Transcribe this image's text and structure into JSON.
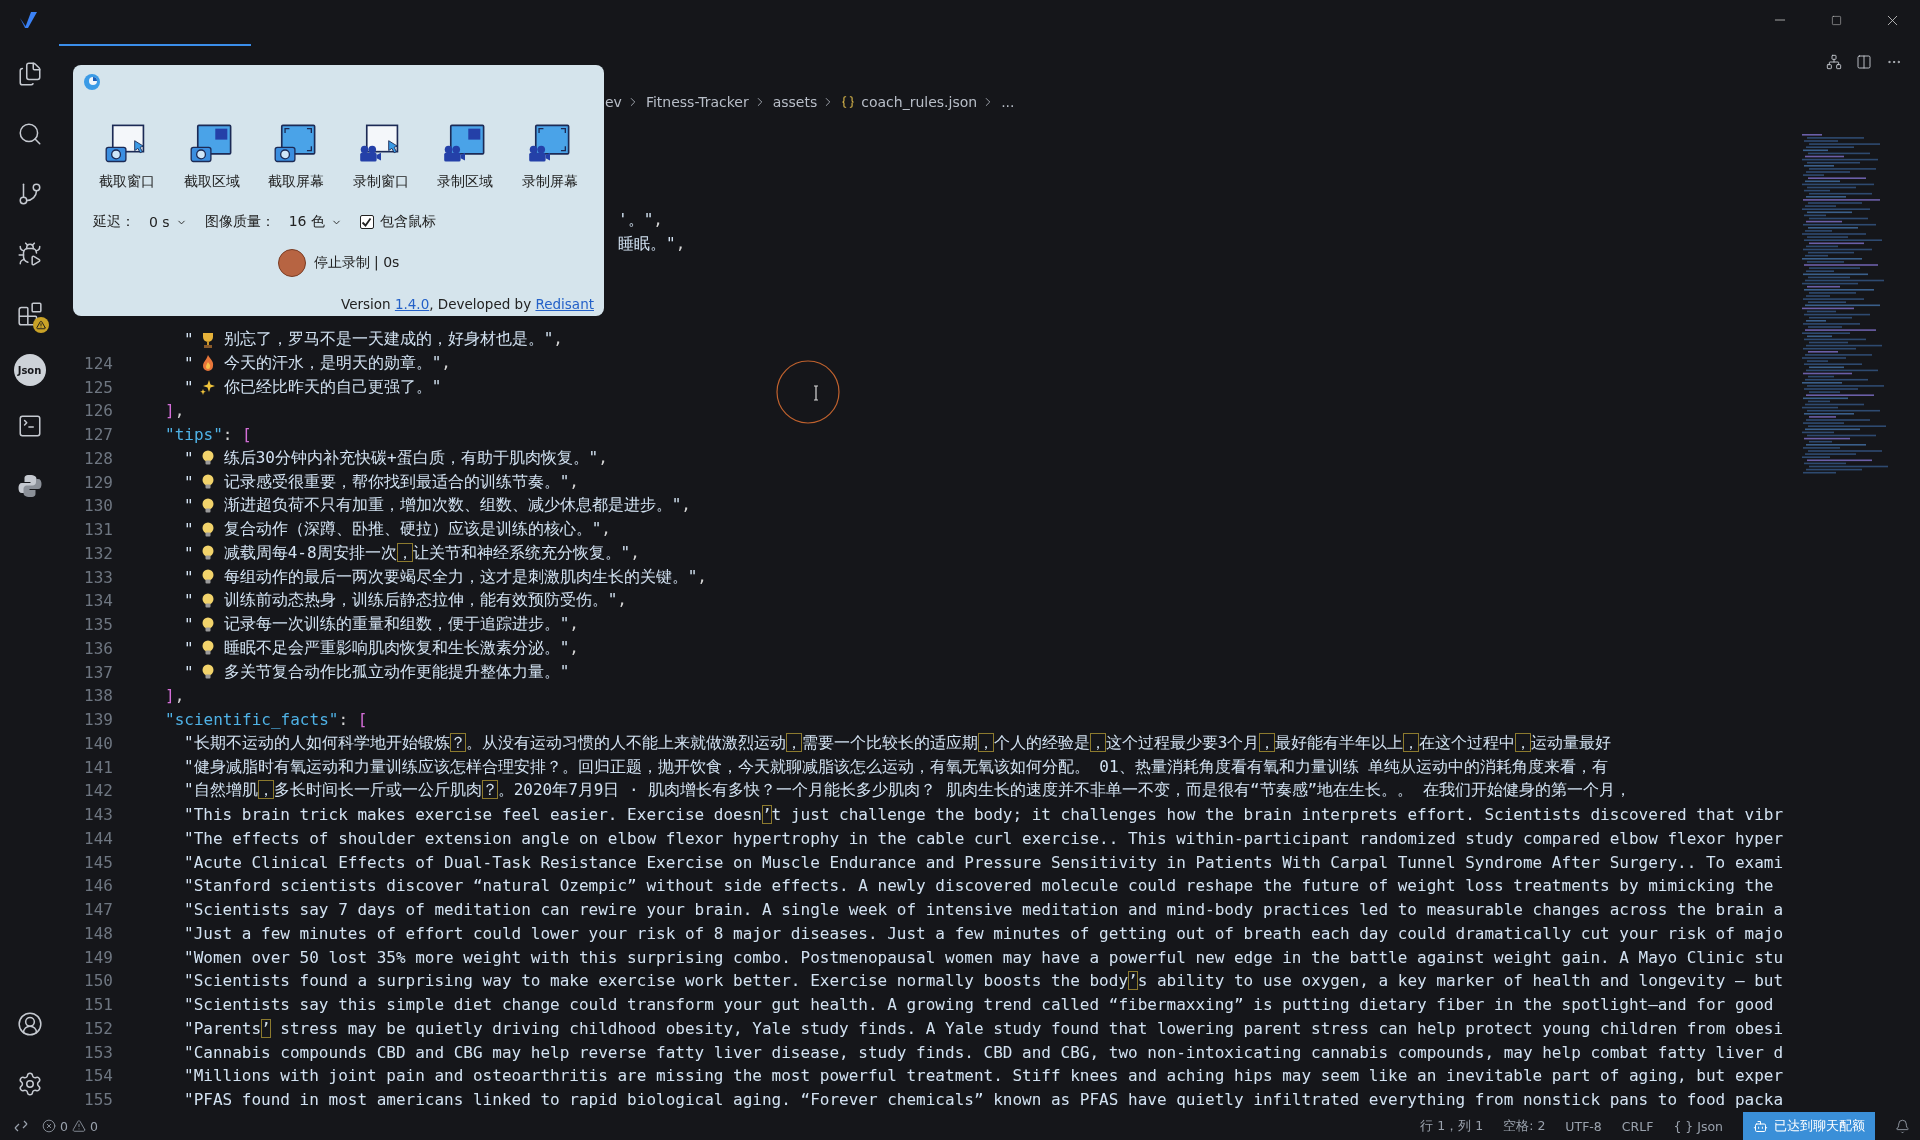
{
  "breadcrumbs": [
    {
      "label": "ev",
      "kind": "folder"
    },
    {
      "label": "Fitness-Tracker",
      "kind": "folder"
    },
    {
      "label": "assets",
      "kind": "folder"
    },
    {
      "label": "coach_rules.json",
      "kind": "json"
    },
    {
      "label": "...",
      "kind": "more"
    }
  ],
  "capture_popup": {
    "tools": [
      {
        "label": "截取窗口",
        "kind": "capture_window"
      },
      {
        "label": "截取区域",
        "kind": "capture_region"
      },
      {
        "label": "截取屏幕",
        "kind": "capture_screen"
      },
      {
        "label": "录制窗口",
        "kind": "record_window"
      },
      {
        "label": "录制区域",
        "kind": "record_region"
      },
      {
        "label": "录制屏幕",
        "kind": "record_screen"
      }
    ],
    "delay_label": "延迟：",
    "delay_value": "0 s",
    "quality_label": "图像质量：",
    "quality_value": "16 色",
    "include_cursor": {
      "label": "包含鼠标",
      "checked": true
    },
    "record_label": "停止录制 | 0s",
    "footer": {
      "prefix": "Version ",
      "version": "1.4.0",
      "middle": ", Developed by ",
      "author": "Redisant"
    }
  },
  "activity_bar": {
    "json_badge": "Json"
  },
  "lines": [
    {
      "kind": "covered"
    },
    {
      "kind": "covered"
    },
    {
      "kind": "covered"
    },
    {
      "kind": "covered"
    },
    {
      "kind": "partial",
      "tokens": [
        {
          "kind": "str",
          "text": "'。\""
        },
        {
          "kind": "punct",
          "text": ","
        }
      ]
    },
    {
      "kind": "partial",
      "tokens": [
        {
          "kind": "str",
          "text": "睡眠。\""
        },
        {
          "kind": "punct",
          "text": ","
        }
      ]
    },
    {
      "kind": "covered"
    },
    {
      "kind": "covered"
    },
    {
      "kind": "covered"
    },
    {
      "kind": "item",
      "tokens": [
        {
          "kind": "str",
          "text": "\""
        },
        {
          "kind": "trophy"
        },
        {
          "kind": "str",
          "text": "别忘了，罗马不是一天建成的，好身材也是。\""
        },
        {
          "kind": "punct",
          "text": ","
        }
      ]
    },
    {
      "kind": "item",
      "number": "124",
      "tokens": [
        {
          "kind": "str",
          "text": "\""
        },
        {
          "kind": "flame"
        },
        {
          "kind": "str",
          "text": "今天的汗水，是明天的勋章。\""
        },
        {
          "kind": "punct",
          "text": ","
        }
      ]
    },
    {
      "kind": "item",
      "number": "125",
      "tokens": [
        {
          "kind": "str",
          "text": "\""
        },
        {
          "kind": "sparkles"
        },
        {
          "kind": "str",
          "text": "你已经比昨天的自己更强了。\""
        }
      ]
    },
    {
      "kind": "close",
      "number": "126",
      "tokens": [
        {
          "kind": "bracket",
          "text": "]"
        },
        {
          "kind": "punct",
          "text": ","
        }
      ]
    },
    {
      "kind": "key",
      "number": "127",
      "tokens": [
        {
          "kind": "key",
          "text": "\"tips\""
        },
        {
          "kind": "punct",
          "text": ": "
        },
        {
          "kind": "bracket",
          "text": "["
        }
      ]
    },
    {
      "kind": "item",
      "number": "128",
      "tokens": [
        {
          "kind": "str",
          "text": "\""
        },
        {
          "kind": "bulb"
        },
        {
          "kind": "str",
          "text": "练后30分钟内补充快碳+蛋白质，有助于肌肉恢复。\""
        },
        {
          "kind": "punct",
          "text": ","
        }
      ]
    },
    {
      "kind": "item",
      "number": "129",
      "tokens": [
        {
          "kind": "str",
          "text": "\""
        },
        {
          "kind": "bulb"
        },
        {
          "kind": "str",
          "text": "记录感受很重要，帮你找到最适合的训练节奏。\""
        },
        {
          "kind": "punct",
          "text": ","
        }
      ]
    },
    {
      "kind": "item",
      "number": "130",
      "tokens": [
        {
          "kind": "str",
          "text": "\""
        },
        {
          "kind": "bulb"
        },
        {
          "kind": "str",
          "text": "渐进超负荷不只有加重，增加次数、组数、减少休息都是进步。\""
        },
        {
          "kind": "punct",
          "text": ","
        }
      ]
    },
    {
      "kind": "item",
      "number": "131",
      "tokens": [
        {
          "kind": "str",
          "text": "\""
        },
        {
          "kind": "bulb"
        },
        {
          "kind": "str",
          "text": "复合动作（深蹲、卧推、硬拉）应该是训练的核心。\""
        },
        {
          "kind": "punct",
          "text": ","
        }
      ]
    },
    {
      "kind": "item",
      "number": "132",
      "tokens": [
        {
          "kind": "str",
          "text": "\""
        },
        {
          "kind": "bulb"
        },
        {
          "kind": "str",
          "text": "减载周每4-8周安排一次"
        },
        {
          "kind": "flag",
          "text": "，"
        },
        {
          "kind": "str",
          "text": "让关节和神经系统充分恢复。\""
        },
        {
          "kind": "punct",
          "text": ","
        }
      ]
    },
    {
      "kind": "item",
      "number": "133",
      "tokens": [
        {
          "kind": "str",
          "text": "\""
        },
        {
          "kind": "bulb"
        },
        {
          "kind": "str",
          "text": "每组动作的最后一两次要竭尽全力，这才是刺激肌肉生长的关键。\""
        },
        {
          "kind": "punct",
          "text": ","
        }
      ]
    },
    {
      "kind": "item",
      "number": "134",
      "tokens": [
        {
          "kind": "str",
          "text": "\""
        },
        {
          "kind": "bulb"
        },
        {
          "kind": "str",
          "text": "训练前动态热身，训练后静态拉伸，能有效预防受伤。\""
        },
        {
          "kind": "punct",
          "text": ","
        }
      ]
    },
    {
      "kind": "item",
      "number": "135",
      "tokens": [
        {
          "kind": "str",
          "text": "\""
        },
        {
          "kind": "bulb"
        },
        {
          "kind": "str",
          "text": "记录每一次训练的重量和组数，便于追踪进步。\""
        },
        {
          "kind": "punct",
          "text": ","
        }
      ]
    },
    {
      "kind": "item",
      "number": "136",
      "tokens": [
        {
          "kind": "str",
          "text": "\""
        },
        {
          "kind": "bulb"
        },
        {
          "kind": "str",
          "text": "睡眠不足会严重影响肌肉恢复和生长激素分泌。\""
        },
        {
          "kind": "punct",
          "text": ","
        }
      ]
    },
    {
      "kind": "item",
      "number": "137",
      "tokens": [
        {
          "kind": "str",
          "text": "\""
        },
        {
          "kind": "bulb"
        },
        {
          "kind": "str",
          "text": "多关节复合动作比孤立动作更能提升整体力量。\""
        }
      ]
    },
    {
      "kind": "close",
      "number": "138",
      "tokens": [
        {
          "kind": "bracket",
          "text": "]"
        },
        {
          "kind": "punct",
          "text": ","
        }
      ]
    },
    {
      "kind": "key",
      "number": "139",
      "tokens": [
        {
          "kind": "key",
          "text": "\"scientific_facts\""
        },
        {
          "kind": "punct",
          "text": ": "
        },
        {
          "kind": "bracket",
          "text": "["
        }
      ]
    },
    {
      "kind": "item",
      "number": "140",
      "tokens": [
        {
          "kind": "str",
          "text": "\"长期不运动的人如何科学地开始锻炼"
        },
        {
          "kind": "flag",
          "text": "？"
        },
        {
          "kind": "str",
          "text": "。从没有运动习惯的人不能上来就做激烈运动"
        },
        {
          "kind": "flag",
          "text": "，"
        },
        {
          "kind": "str",
          "text": "需要一个比较长的适应期"
        },
        {
          "kind": "flag",
          "text": "，"
        },
        {
          "kind": "str",
          "text": "个人的经验是"
        },
        {
          "kind": "flag",
          "text": "，"
        },
        {
          "kind": "str",
          "text": "这个过程最少要3个月"
        },
        {
          "kind": "flag",
          "text": "，"
        },
        {
          "kind": "str",
          "text": "最好能有半年以上"
        },
        {
          "kind": "flag",
          "text": "，"
        },
        {
          "kind": "str",
          "text": "在这个过程中"
        },
        {
          "kind": "flag",
          "text": "，"
        },
        {
          "kind": "str",
          "text": "运动量最好"
        }
      ]
    },
    {
      "kind": "item",
      "number": "141",
      "tokens": [
        {
          "kind": "str",
          "text": "\"健身减脂时有氧运动和力量训练应该怎样合理安排？。回归正题，抛开饮食，今天就聊减脂该怎么运动，有氧无氧该如何分配。 01、热量消耗角度看有氧和力量训练 单纯从运动中的消耗角度来看，有"
        }
      ]
    },
    {
      "kind": "item",
      "number": "142",
      "tokens": [
        {
          "kind": "str",
          "text": "\"自然增肌"
        },
        {
          "kind": "flag",
          "text": "，"
        },
        {
          "kind": "str",
          "text": "多长时间长一斤或一公斤肌肉"
        },
        {
          "kind": "flag",
          "text": "？"
        },
        {
          "kind": "str",
          "text": "。2020年7月9日 · 肌肉增长有多快？一个月能长多少肌肉？ 肌肉生长的速度并不非单一不变，而是很有“节奏感”地在生长。。 在我们开始健身的第一个月，"
        }
      ]
    },
    {
      "kind": "item",
      "number": "143",
      "tokens": [
        {
          "kind": "str",
          "text": "\"This brain trick makes exercise feel easier. Exercise doesn"
        },
        {
          "kind": "flag",
          "text": "’"
        },
        {
          "kind": "str",
          "text": "t just challenge the body; it challenges how the brain interprets effort. Scientists discovered that vibr"
        }
      ]
    },
    {
      "kind": "item",
      "number": "144",
      "tokens": [
        {
          "kind": "str",
          "text": "\"The effects of shoulder extension angle on elbow flexor hypertrophy in the cable curl exercise.. This within-participant randomized study compared elbow flexor hyper"
        }
      ]
    },
    {
      "kind": "item",
      "number": "145",
      "tokens": [
        {
          "kind": "str",
          "text": "\"Acute Clinical Effects of Dual-Task Resistance Exercise on Muscle Endurance and Pressure Sensitivity in Patients With Carpal Tunnel Syndrome After Surgery.. To exami"
        }
      ]
    },
    {
      "kind": "item",
      "number": "146",
      "tokens": [
        {
          "kind": "str",
          "text": "\"Stanford scientists discover “natural Ozempic” without side effects. A newly discovered molecule could reshape the future of weight loss treatments by mimicking the"
        }
      ]
    },
    {
      "kind": "item",
      "number": "147",
      "tokens": [
        {
          "kind": "str",
          "text": "\"Scientists say 7 days of meditation can rewire your brain. A single week of intensive meditation and mind-body practices led to measurable changes across the brain a"
        }
      ]
    },
    {
      "kind": "item",
      "number": "148",
      "tokens": [
        {
          "kind": "str",
          "text": "\"Just a few minutes of effort could lower your risk of 8 major diseases. Just a few minutes of getting out of breath each day could dramatically cut your risk of majo"
        }
      ]
    },
    {
      "kind": "item",
      "number": "149",
      "tokens": [
        {
          "kind": "str",
          "text": "\"Women over 50 lost 35% more weight with this surprising combo. Postmenopausal women may have a powerful new edge in the battle against weight gain. A Mayo Clinic stu"
        }
      ]
    },
    {
      "kind": "item",
      "number": "150",
      "tokens": [
        {
          "kind": "str",
          "text": "\"Scientists found a surprising way to make exercise work better. Exercise normally boosts the body"
        },
        {
          "kind": "flag",
          "text": "’"
        },
        {
          "kind": "str",
          "text": "s ability to use oxygen, a key marker of health and longevity — but"
        }
      ]
    },
    {
      "kind": "item",
      "number": "151",
      "tokens": [
        {
          "kind": "str",
          "text": "\"Scientists say this simple diet change could transform your gut health. A growing trend called “fibermaxxing” is putting dietary fiber in the spotlight—and for good"
        }
      ]
    },
    {
      "kind": "item",
      "number": "152",
      "tokens": [
        {
          "kind": "str",
          "text": "\"Parents"
        },
        {
          "kind": "flag",
          "text": "’"
        },
        {
          "kind": "str",
          "text": " stress may be quietly driving childhood obesity, Yale study finds. A Yale study found that lowering parent stress can help protect young children from obesi"
        }
      ]
    },
    {
      "kind": "item",
      "number": "153",
      "tokens": [
        {
          "kind": "str",
          "text": "\"Cannabis compounds CBD and CBG may help reverse fatty liver disease, study finds. CBD and CBG, two non-intoxicating cannabis compounds, may help combat fatty liver d"
        }
      ]
    },
    {
      "kind": "item",
      "number": "154",
      "tokens": [
        {
          "kind": "str",
          "text": "\"Millions with joint pain and osteoarthritis are missing the most powerful treatment. Stiff knees and aching hips may seem like an inevitable part of aging, but exper"
        }
      ]
    },
    {
      "kind": "item",
      "number": "155",
      "tokens": [
        {
          "kind": "str",
          "text": "\"PFAS found in most americans linked to rapid biological aging. “Forever chemicals” known as PFAS have quietly infiltrated everything from nonstick pans to food packa"
        }
      ]
    }
  ],
  "status_bar": {
    "errors": "0",
    "warnings": "0",
    "items": [
      "行 1，列 1",
      "空格: 2",
      "UTF-8",
      "CRLF",
      "{ } Json"
    ],
    "chat_quota": "已达到聊天配额"
  }
}
